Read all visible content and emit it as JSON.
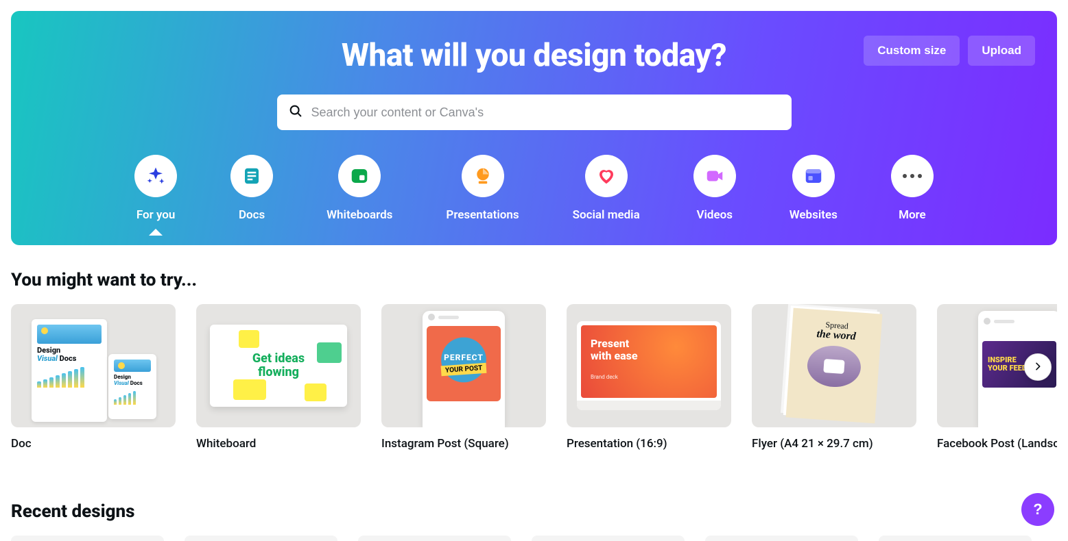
{
  "hero": {
    "title": "What will you design today?",
    "custom_size_label": "Custom size",
    "upload_label": "Upload",
    "search_placeholder": "Search your content or Canva's"
  },
  "categories": [
    {
      "id": "for-you",
      "label": "For you",
      "icon": "sparkle",
      "color": "#2b3fe0",
      "active": true
    },
    {
      "id": "docs",
      "label": "Docs",
      "icon": "doc",
      "color": "#13a3b5",
      "active": false
    },
    {
      "id": "whiteboards",
      "label": "Whiteboards",
      "icon": "board",
      "color": "#0ba84a",
      "active": false
    },
    {
      "id": "presentations",
      "label": "Presentations",
      "icon": "chart",
      "color": "#ff9a1f",
      "active": false
    },
    {
      "id": "social-media",
      "label": "Social media",
      "icon": "heart",
      "color": "#ff3b5c",
      "active": false
    },
    {
      "id": "videos",
      "label": "Videos",
      "icon": "video",
      "color": "#d269ff",
      "active": false
    },
    {
      "id": "websites",
      "label": "Websites",
      "icon": "layout",
      "color": "#4a52ff",
      "active": false
    },
    {
      "id": "more",
      "label": "More",
      "icon": "more",
      "color": "#4a4a4a",
      "active": false
    }
  ],
  "sections": {
    "try_title": "You might want to try...",
    "recent_title": "Recent designs"
  },
  "try_cards": [
    {
      "id": "doc",
      "label": "Doc"
    },
    {
      "id": "whiteboard",
      "label": "Whiteboard"
    },
    {
      "id": "instagram-post",
      "label": "Instagram Post (Square)"
    },
    {
      "id": "presentation",
      "label": "Presentation (16:9)"
    },
    {
      "id": "flyer",
      "label": "Flyer (A4 21 × 29.7 cm)"
    },
    {
      "id": "facebook-post",
      "label": "Facebook Post (Landscape)"
    }
  ],
  "thumbs": {
    "doc": {
      "title_a": "Design",
      "title_b": "Visual",
      "title_c": "Docs"
    },
    "whiteboard": {
      "text": "Get ideas flowing"
    },
    "instagram": {
      "line1": "PERFECT",
      "line2": "YOUR POST"
    },
    "presentation": {
      "line1": "Present with ease",
      "line2": "Brand deck"
    },
    "flyer": {
      "line1": "Spread",
      "line2": "the word"
    },
    "facebook": {
      "text": "INSPIRE YOUR FEED"
    }
  },
  "help_label": "?"
}
